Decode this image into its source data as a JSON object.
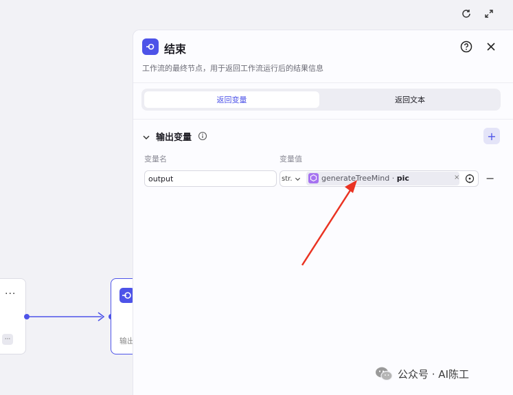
{
  "panel": {
    "title": "结束",
    "description": "工作流的最终节点，用于返回工作流运行后的结果信息",
    "tabs": [
      "返回变量",
      "返回文本"
    ],
    "section_title": "输出变量",
    "columns": {
      "name": "变量名",
      "value": "变量值"
    },
    "row": {
      "name_value": "output",
      "type": "str.",
      "ref_node": "generateTreeMind",
      "ref_sep": " · ",
      "ref_field": "pic",
      "chip_close": "×"
    },
    "add_label": "+",
    "remove_label": "−"
  },
  "canvas": {
    "left_node_more": "···",
    "left_node_mini": "···",
    "end_node_text": "输出"
  },
  "watermark": {
    "text": "公众号 · AI陈工"
  },
  "colors": {
    "accent": "#4d53e8",
    "annotation_arrow": "#ea3323",
    "plugin": "#a673f0"
  },
  "icons": [
    "refresh-icon",
    "fullscreen-icon",
    "end-node-icon",
    "help-icon",
    "close-icon",
    "chevron-down-icon",
    "info-icon",
    "plus-icon",
    "plugin-icon",
    "target-icon",
    "wechat-icon"
  ]
}
